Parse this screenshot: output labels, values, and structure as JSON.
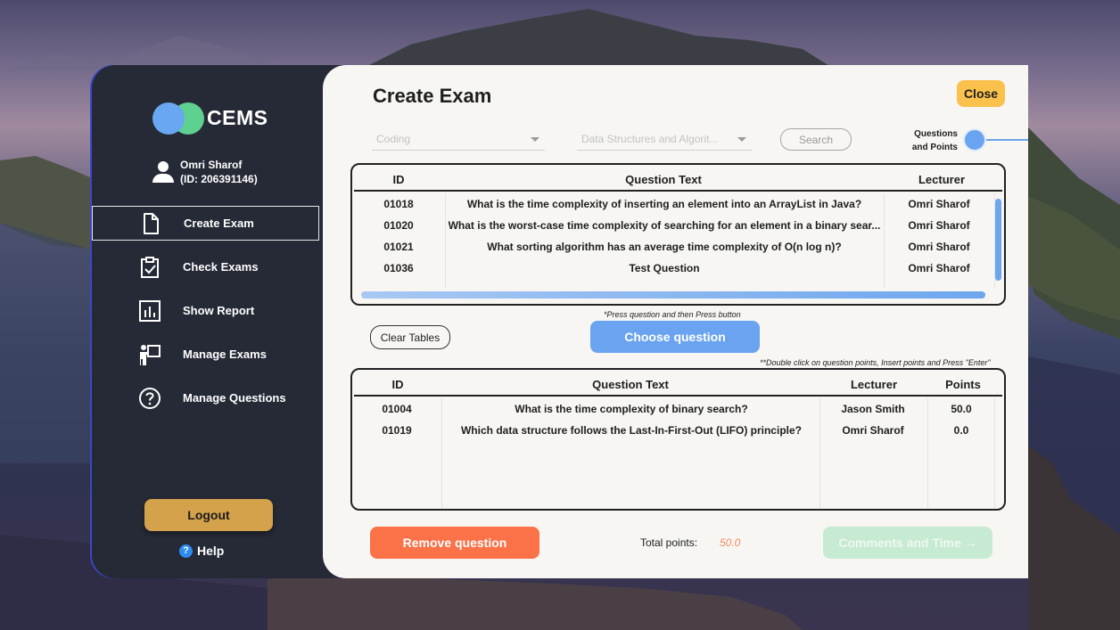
{
  "app": {
    "logo_text": "CEMS",
    "user_name": "Omri Sharof",
    "user_id": "(ID: 206391146)"
  },
  "sidebar": {
    "items": [
      {
        "label": "Create Exam",
        "icon": "document-icon",
        "active": true
      },
      {
        "label": "Check Exams",
        "icon": "clipboard-check-icon",
        "active": false
      },
      {
        "label": "Show Report",
        "icon": "bar-chart-icon",
        "active": false
      },
      {
        "label": "Manage Exams",
        "icon": "presenter-icon",
        "active": false
      },
      {
        "label": "Manage Questions",
        "icon": "question-circle-icon",
        "active": false
      }
    ],
    "logout_label": "Logout",
    "help_label": "Help"
  },
  "main": {
    "title": "Create Exam",
    "close_label": "Close",
    "subject_placeholder": "Coding",
    "course_placeholder": "Data Structures and Algorit...",
    "search_label": "Search",
    "step_label_line1": "Questions",
    "step_label_line2": "and Points",
    "hint_choose": "*Press question and then Press button",
    "hint_points": "**Double click on question points, Insert points and Press \"Enter\"",
    "clear_label": "Clear Tables",
    "choose_label": "Choose question",
    "remove_label": "Remove question",
    "total_label": "Total points:",
    "total_value": "50.0",
    "comments_label": "Comments and Time →"
  },
  "question_bank": {
    "headers": [
      "ID",
      "Question Text",
      "Lecturer"
    ],
    "rows": [
      {
        "id": "01018",
        "text": "What is the time complexity of inserting an element into an ArrayList in Java?",
        "lecturer": "Omri Sharof"
      },
      {
        "id": "01020",
        "text": "What is the worst-case time complexity of searching for an element in a binary sear...",
        "lecturer": "Omri Sharof"
      },
      {
        "id": "01021",
        "text": "What sorting algorithm has an average time complexity of O(n log n)?",
        "lecturer": "Omri Sharof"
      },
      {
        "id": "01036",
        "text": "Test Question",
        "lecturer": "Omri Sharof"
      }
    ]
  },
  "selected_questions": {
    "headers": [
      "ID",
      "Question Text",
      "Lecturer",
      "Points"
    ],
    "rows": [
      {
        "id": "01004",
        "text": "What is the time complexity of binary search?",
        "lecturer": "Jason Smith",
        "points": "50.0"
      },
      {
        "id": "01019",
        "text": "Which data structure follows the Last-In-First-Out (LIFO) principle?",
        "lecturer": "Omri Sharof",
        "points": "0.0"
      }
    ]
  },
  "colors": {
    "sidebar_bg": "#252a36",
    "accent_blue": "#6aa3ef",
    "close_yellow": "#fbc14d",
    "logout_gold": "#d4a24a",
    "remove_orange": "#fb7148",
    "comments_green": "#c7ead2"
  }
}
